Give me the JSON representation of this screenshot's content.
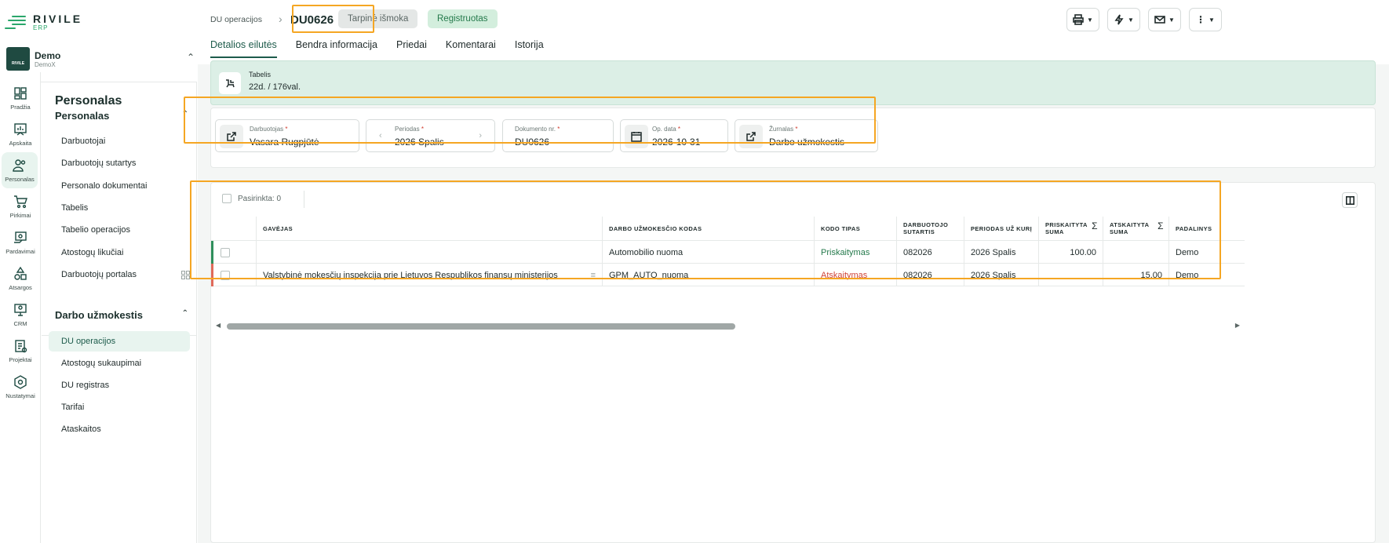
{
  "brand": {
    "name": "RIVILE",
    "sub": "ERP"
  },
  "company": {
    "name": "Demo",
    "sub": "DemoX",
    "avatar_text": "RIVILE"
  },
  "rail": [
    {
      "label": "Pradžia",
      "icon": "home-grid-icon"
    },
    {
      "label": "Apskaita",
      "icon": "chart-board-icon"
    },
    {
      "label": "Personalas",
      "icon": "people-icon"
    },
    {
      "label": "Pirkimai",
      "icon": "cart-icon"
    },
    {
      "label": "Pardavimai",
      "icon": "sales-icon"
    },
    {
      "label": "Atsargos",
      "icon": "shapes-icon"
    },
    {
      "label": "CRM",
      "icon": "crm-monitor-icon"
    },
    {
      "label": "Projektai",
      "icon": "clipboard-check-icon"
    },
    {
      "label": "Nustatymai",
      "icon": "settings-hex-icon"
    }
  ],
  "sidebar": {
    "title": "Personalas",
    "section1": {
      "title": "Personalas",
      "items": [
        "Darbuotojai",
        "Darbuotojų sutartys",
        "Personalo dokumentai",
        "Tabelis",
        "Tabelio operacijos",
        "Atostogų likučiai",
        "Darbuotojų portalas"
      ]
    },
    "section2": {
      "title": "Darbo užmokestis",
      "items": [
        "DU operacijos",
        "Atostogų sukaupimai",
        "DU registras",
        "Tarifai",
        "Ataskaitos"
      ]
    }
  },
  "header": {
    "breadcrumb": "DU operacijos",
    "doc_id": "DU0626",
    "badge_draft": "Tarpinė išmoka",
    "badge_status": "Registruotas"
  },
  "tabs": [
    "Detalios eilutės",
    "Bendra informacija",
    "Priedai",
    "Komentarai",
    "Istorija"
  ],
  "tabelis": {
    "label": "Tabelis",
    "value": "22d. / 176val."
  },
  "fields": {
    "employee": {
      "label": "Darbuotojas",
      "req": "*",
      "value": "Vasara Rugpjūtė"
    },
    "period": {
      "label": "Periodas",
      "req": "*",
      "value": "2026 Spalis"
    },
    "doc_no": {
      "label": "Dokumento nr.",
      "req": "*",
      "value": "DU0626"
    },
    "op_date": {
      "label": "Op. data",
      "req": "*",
      "value": "2026-10-31"
    },
    "journal": {
      "label": "Žurnalas",
      "req": "*",
      "value": "Darbo užmokestis"
    }
  },
  "selection": {
    "label": "Pasirinkta: 0"
  },
  "table": {
    "headers": [
      "GAVĖJAS",
      "DARBO UŽMOKESČIO KODAS",
      "KODO TIPAS",
      "DARBUOTOJO SUTARTIS",
      "PERIODAS UŽ KURĮ",
      "PRISKAITYTA SUMA",
      "ATSKAITYTA SUMA",
      "PADALINYS"
    ],
    "sigma": "Σ",
    "rows": [
      {
        "recipient": "",
        "code": "Automobilio nuoma",
        "type": "Priskaitymas",
        "contract": "082026",
        "period": "2026 Spalis",
        "accrued": "100.00",
        "deducted": "",
        "unit": "Demo",
        "mark_color": "#2f8f5c"
      },
      {
        "recipient": "Valstybinė mokesčių inspekcija prie Lietuvos Respublikos finansų ministerijos",
        "code": "GPM_AUTO_nuoma",
        "type": "Atskaitymas",
        "contract": "082026",
        "period": "2026 Spalis",
        "accrued": "",
        "deducted": "15.00",
        "unit": "Demo",
        "mark_color": "#e06a5a"
      }
    ]
  },
  "colors": {
    "accent": "#1d5b4b",
    "highlight": "#f5a623",
    "positive": "#257a4c",
    "negative": "#d0453a"
  }
}
